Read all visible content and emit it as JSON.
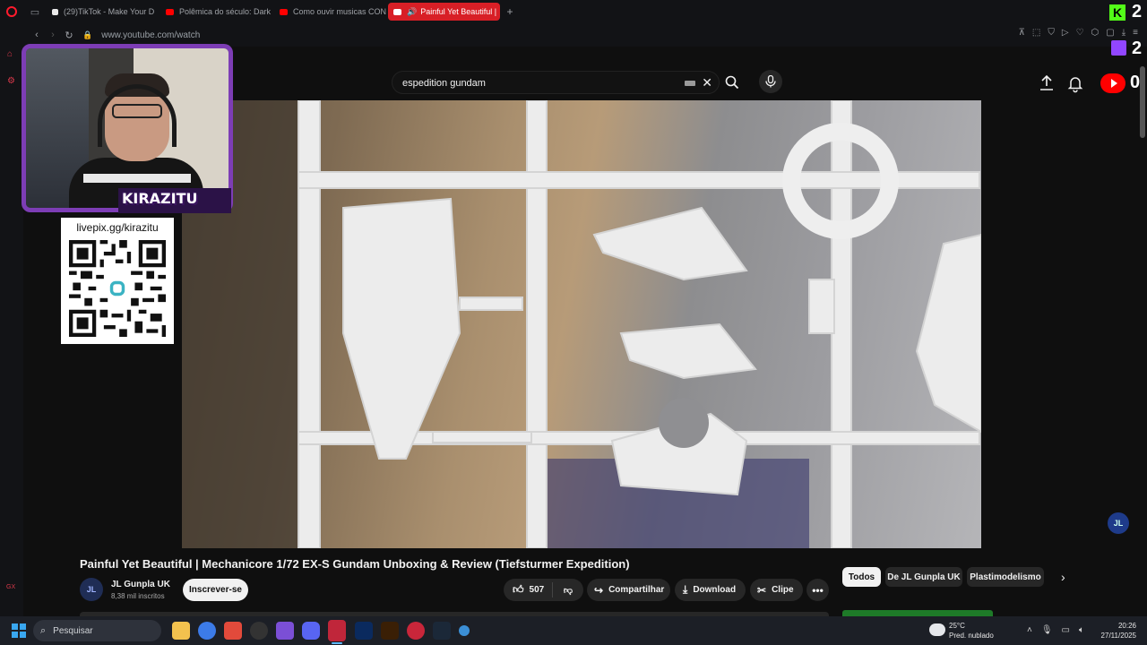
{
  "browser": {
    "tabs": [
      {
        "label": "(29)TikTok - Make Your D",
        "favicon_color": "#eaeaea",
        "active": false
      },
      {
        "label": "Polêmica do século: Dark",
        "favicon_color": "#ff0000",
        "active": false
      },
      {
        "label": "Como ouvir musicas CON",
        "favicon_color": "#ff0000",
        "active": false
      },
      {
        "label": "Painful Yet Beautiful |",
        "favicon_color": "#ffffff",
        "active": true
      }
    ],
    "new_tab_label": "+",
    "url": "www.youtube.com/watch"
  },
  "youtube": {
    "search_value": "espedition gundam",
    "video_title": "Painful Yet Beautiful | Mechanicore 1/72 EX-S Gundam Unboxing & Review (Tiefsturmer Expedition)",
    "channel_avatar_text": "JL",
    "channel_name": "JL Gunpla UK",
    "subscribers": "8,38 mil inscritos",
    "subscribe_label": "Inscrever-se",
    "like_count": "507",
    "share_label": "Compartilhar",
    "download_label": "Download",
    "clip_label": "Clipe",
    "more_label": "•••",
    "chips": [
      "Todos",
      "De JL Gunpla UK",
      "Plastimodelismo"
    ],
    "watermark_text": "JL"
  },
  "stream_overlay": {
    "cam_name": "KIRAZITU",
    "livepix_url": "livepix.gg/kirazitu",
    "kick_logo_text": "K",
    "kick_count": "2",
    "twitch_count": "2",
    "youtube_count": "0"
  },
  "taskbar": {
    "search_placeholder": "Pesquisar",
    "weather_temp": "25°C",
    "weather_desc": "Pred. nublado",
    "time": "20:26",
    "date": "27/11/2025"
  },
  "sidebar": {
    "gx_label": "GX"
  },
  "colors": {
    "accent_red": "#d81f26",
    "twitch_purple": "#9146ff",
    "kick_green": "#53fc18",
    "youtube_red": "#ff0000"
  }
}
